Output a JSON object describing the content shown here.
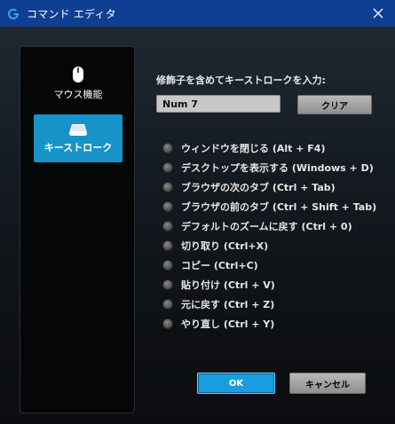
{
  "window": {
    "title": "コマンド エディタ"
  },
  "sidebar": {
    "items": [
      {
        "label": "マウス機能",
        "icon": "mouse-icon",
        "selected": false
      },
      {
        "label": "キーストローク",
        "icon": "keycap-icon",
        "selected": true
      }
    ]
  },
  "main": {
    "prompt": "修飾子を含めてキーストロークを入力:",
    "keystroke_value": "Num 7",
    "clear_label": "クリア",
    "options": [
      "ウィンドウを閉じる (Alt + F4)",
      "デスクトップを表示する (Windows + D)",
      "ブラウザの次のタブ (Ctrl + Tab)",
      "ブラウザの前のタブ (Ctrl + Shift + Tab)",
      "デフォルトのズームに戻す (Ctrl + 0)",
      "切り取り (Ctrl+X)",
      "コピー (Ctrl+C)",
      "貼り付け (Ctrl + V)",
      "元に戻す (Ctrl + Z)",
      "やり直し (Ctrl + Y)"
    ]
  },
  "footer": {
    "ok_label": "OK",
    "cancel_label": "キャンセル"
  },
  "colors": {
    "titlebar": "#0f3f93",
    "accent": "#1893c9",
    "ok": "#1a9de0"
  }
}
